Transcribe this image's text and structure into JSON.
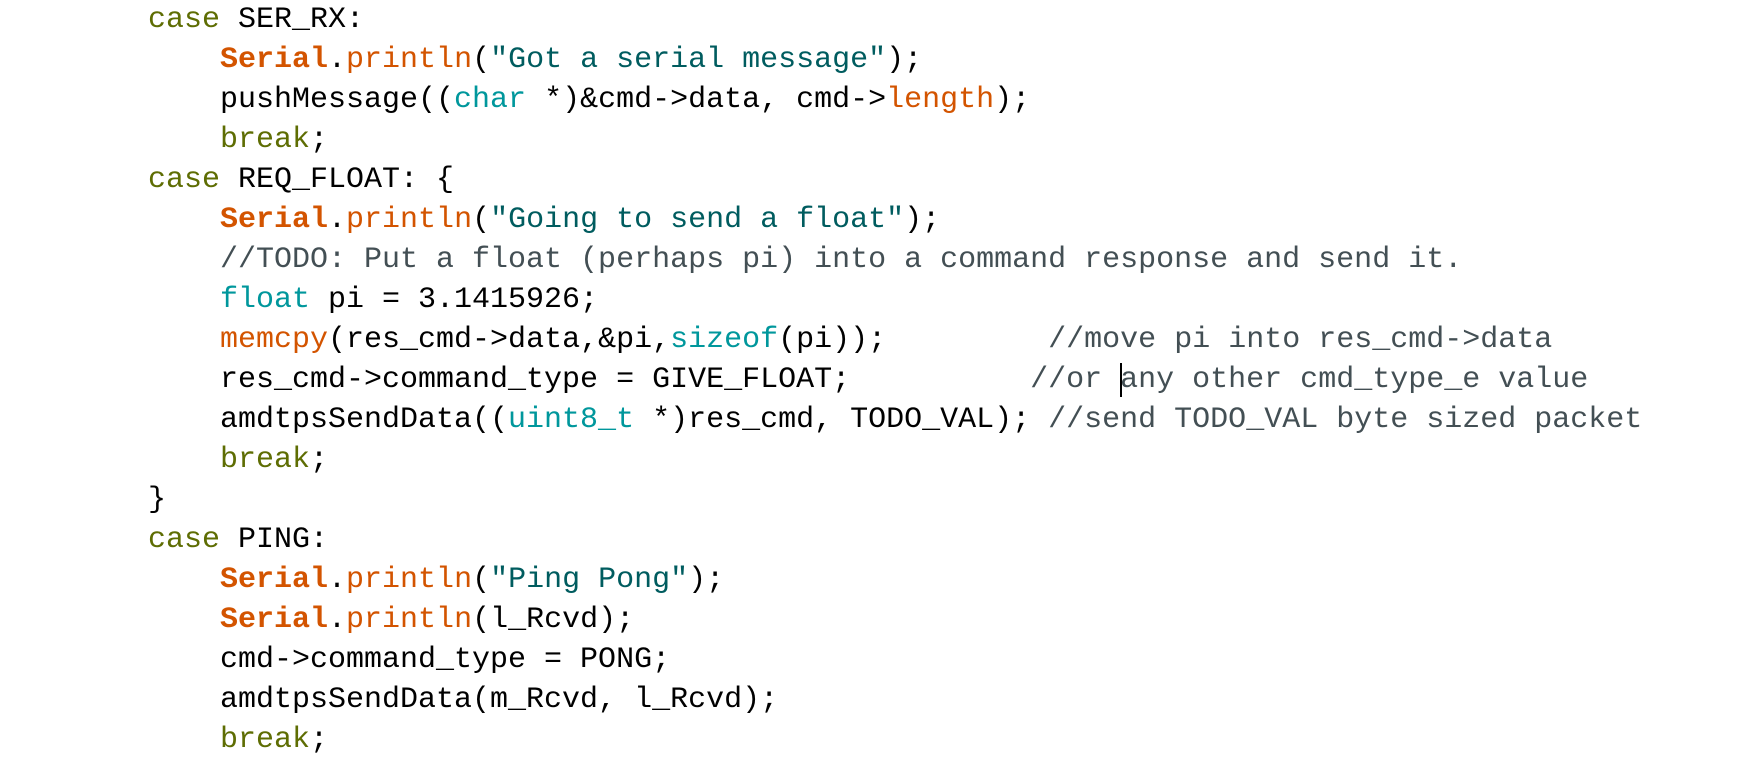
{
  "editor": {
    "colors": {
      "background": "#ffffff",
      "keyword": "#5e6d03",
      "class": "#d35400",
      "function": "#d35400",
      "type": "#00979c",
      "string": "#005c5f",
      "comment": "#434f54",
      "plain": "#000000"
    },
    "caret": {
      "line": 9,
      "column": 50
    },
    "lines": [
      {
        "indent": 0,
        "tokens": [
          {
            "t": "case",
            "k": "kw"
          },
          {
            "t": " SER_RX:",
            "k": "plain"
          }
        ]
      },
      {
        "indent": 4,
        "tokens": [
          {
            "t": "Serial",
            "k": "cls"
          },
          {
            "t": ".",
            "k": "plain"
          },
          {
            "t": "println",
            "k": "fn"
          },
          {
            "t": "(",
            "k": "plain"
          },
          {
            "t": "\"Got a serial message\"",
            "k": "str"
          },
          {
            "t": ");",
            "k": "plain"
          }
        ]
      },
      {
        "indent": 4,
        "tokens": [
          {
            "t": "pushMessage((",
            "k": "plain"
          },
          {
            "t": "char",
            "k": "type"
          },
          {
            "t": " *)&cmd->data, cmd->",
            "k": "plain"
          },
          {
            "t": "length",
            "k": "fn"
          },
          {
            "t": ");",
            "k": "plain"
          }
        ]
      },
      {
        "indent": 4,
        "tokens": [
          {
            "t": "break",
            "k": "kw"
          },
          {
            "t": ";",
            "k": "plain"
          }
        ]
      },
      {
        "indent": 0,
        "tokens": [
          {
            "t": "case",
            "k": "kw"
          },
          {
            "t": " REQ_FLOAT: {",
            "k": "plain"
          }
        ]
      },
      {
        "indent": 4,
        "tokens": [
          {
            "t": "Serial",
            "k": "cls"
          },
          {
            "t": ".",
            "k": "plain"
          },
          {
            "t": "println",
            "k": "fn"
          },
          {
            "t": "(",
            "k": "plain"
          },
          {
            "t": "\"Going to send a float\"",
            "k": "str"
          },
          {
            "t": ");",
            "k": "plain"
          }
        ]
      },
      {
        "indent": 4,
        "tokens": [
          {
            "t": "//TODO: Put a float (perhaps pi) into a command response and send it.",
            "k": "cmt"
          }
        ]
      },
      {
        "indent": 4,
        "tokens": [
          {
            "t": "float",
            "k": "type"
          },
          {
            "t": " pi = 3.1415926;",
            "k": "plain"
          }
        ]
      },
      {
        "indent": 4,
        "tokens": [
          {
            "t": "memcpy",
            "k": "fn"
          },
          {
            "t": "(res_cmd->data,&pi,",
            "k": "plain"
          },
          {
            "t": "sizeof",
            "k": "type"
          },
          {
            "t": "(pi));         ",
            "k": "plain"
          },
          {
            "t": "//move pi into res_cmd->data",
            "k": "cmt"
          }
        ]
      },
      {
        "indent": 4,
        "tokens": [
          {
            "t": "res_cmd->command_type = GIVE_FLOAT;          ",
            "k": "plain"
          },
          {
            "t": "//or any other cmd_type_e value",
            "k": "cmt"
          }
        ]
      },
      {
        "indent": 4,
        "tokens": [
          {
            "t": "amdtpsSendData((",
            "k": "plain"
          },
          {
            "t": "uint8_t",
            "k": "type"
          },
          {
            "t": " *)res_cmd, TODO_VAL); ",
            "k": "plain"
          },
          {
            "t": "//send TODO_VAL byte sized packet",
            "k": "cmt"
          }
        ]
      },
      {
        "indent": 4,
        "tokens": [
          {
            "t": "break",
            "k": "kw"
          },
          {
            "t": ";",
            "k": "plain"
          }
        ]
      },
      {
        "indent": 0,
        "tokens": [
          {
            "t": "}",
            "k": "plain"
          }
        ]
      },
      {
        "indent": 0,
        "tokens": [
          {
            "t": "case",
            "k": "kw"
          },
          {
            "t": " PING:",
            "k": "plain"
          }
        ]
      },
      {
        "indent": 4,
        "tokens": [
          {
            "t": "Serial",
            "k": "cls"
          },
          {
            "t": ".",
            "k": "plain"
          },
          {
            "t": "println",
            "k": "fn"
          },
          {
            "t": "(",
            "k": "plain"
          },
          {
            "t": "\"Ping Pong\"",
            "k": "str"
          },
          {
            "t": ");",
            "k": "plain"
          }
        ]
      },
      {
        "indent": 4,
        "tokens": [
          {
            "t": "Serial",
            "k": "cls"
          },
          {
            "t": ".",
            "k": "plain"
          },
          {
            "t": "println",
            "k": "fn"
          },
          {
            "t": "(l_Rcvd);",
            "k": "plain"
          }
        ]
      },
      {
        "indent": 4,
        "tokens": [
          {
            "t": "cmd->command_type = PONG;",
            "k": "plain"
          }
        ]
      },
      {
        "indent": 4,
        "tokens": [
          {
            "t": "amdtpsSendData(m_Rcvd, l_Rcvd);",
            "k": "plain"
          }
        ]
      },
      {
        "indent": 4,
        "tokens": [
          {
            "t": "break",
            "k": "kw"
          },
          {
            "t": ";",
            "k": "plain"
          }
        ]
      }
    ]
  }
}
